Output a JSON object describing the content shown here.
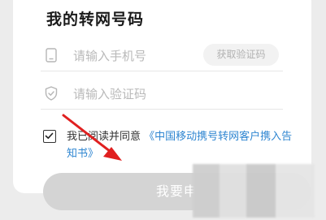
{
  "page_title": "我的转网号码",
  "phone_row": {
    "icon": "phone-icon",
    "placeholder": "请输入手机号",
    "get_code_label": "获取验证码"
  },
  "code_row": {
    "icon": "shield-check-icon",
    "placeholder": "请输入验证码"
  },
  "agreement": {
    "checked": true,
    "prefix": "我已阅读并同意",
    "link": "《中国移动携号转网客户携入告知书》"
  },
  "submit_label": "我要申",
  "colors": {
    "link": "#2f86d1",
    "annotation_arrow": "#e02020",
    "submit_disabled": "#d4d4d4"
  }
}
